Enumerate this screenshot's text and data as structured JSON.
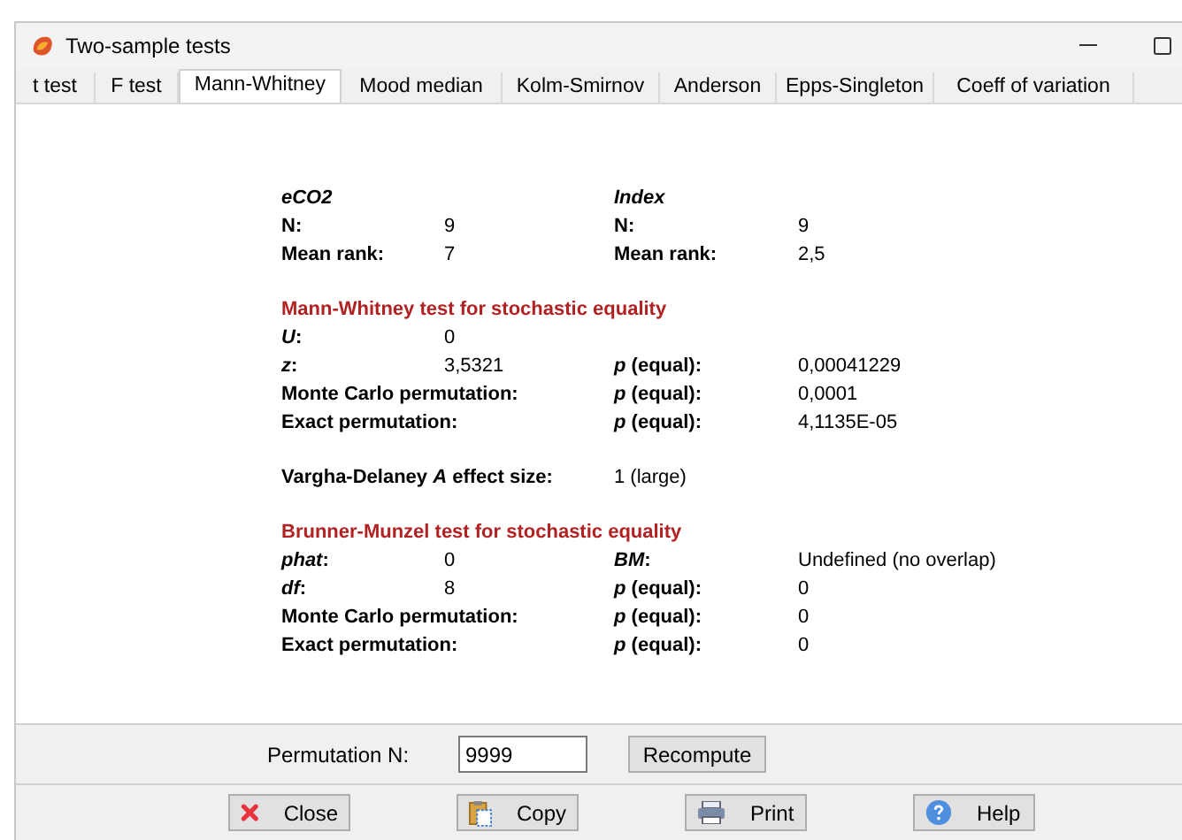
{
  "window": {
    "title": "Two-sample tests"
  },
  "tabs": [
    {
      "label": "t test",
      "selected": false
    },
    {
      "label": "F test",
      "selected": false
    },
    {
      "label": "Mann-Whitney",
      "selected": true
    },
    {
      "label": "Mood median",
      "selected": false
    },
    {
      "label": "Kolm-Smirnov",
      "selected": false
    },
    {
      "label": "Anderson",
      "selected": false
    },
    {
      "label": "Epps-Singleton",
      "selected": false
    },
    {
      "label": "Coeff of variation",
      "selected": false
    }
  ],
  "sections": [
    {
      "rows": [
        {
          "kind": "group",
          "label": "eCO2",
          "label2": "Index"
        },
        {
          "kind": "pair",
          "label": "N:",
          "value": "9",
          "label2": "N:",
          "value2": "9"
        },
        {
          "kind": "pair",
          "label": "Mean rank:",
          "value": "7",
          "label2": "Mean rank:",
          "value2": "2,5"
        }
      ]
    },
    {
      "heading": "Mann-Whitney test for stochastic equality",
      "rows": [
        {
          "kind": "pair",
          "label": "*U*:",
          "value": "0"
        },
        {
          "kind": "pair",
          "label": "*z*:",
          "value": "3,5321",
          "label2": "*p* (equal):",
          "value2": "0,00041229"
        },
        {
          "kind": "pair",
          "label": "Monte Carlo permutation:",
          "label2": "*p* (equal):",
          "value2": "0,0001"
        },
        {
          "kind": "pair",
          "label": "Exact permutation:",
          "label2": "*p* (equal):",
          "value2": "4,1135E-05"
        }
      ]
    },
    {
      "rows": [
        {
          "kind": "wide",
          "label": "Vargha-Delaney *A* effect size:",
          "value": "1 (large)"
        }
      ]
    },
    {
      "heading": "Brunner-Munzel test for stochastic equality",
      "rows": [
        {
          "kind": "pair",
          "label": "*phat*:",
          "value": "0",
          "label2": "*BM*:",
          "value2": "Undefined (no overlap)"
        },
        {
          "kind": "pair",
          "label": "*df*:",
          "value": "8",
          "label2": "*p* (equal):",
          "value2": "0"
        },
        {
          "kind": "pair",
          "label": "Monte Carlo permutation:",
          "label2": "*p* (equal):",
          "value2": "0"
        },
        {
          "kind": "pair",
          "label": "Exact permutation:",
          "label2": "*p* (equal):",
          "value2": "0"
        }
      ]
    }
  ],
  "permutation": {
    "label": "Permutation N:",
    "value": "9999",
    "button": "Recompute"
  },
  "buttons": [
    {
      "kind": "close",
      "label": "Close"
    },
    {
      "kind": "copy",
      "label": "Copy"
    },
    {
      "kind": "print",
      "label": "Print"
    },
    {
      "kind": "help",
      "label": "Help"
    }
  ]
}
